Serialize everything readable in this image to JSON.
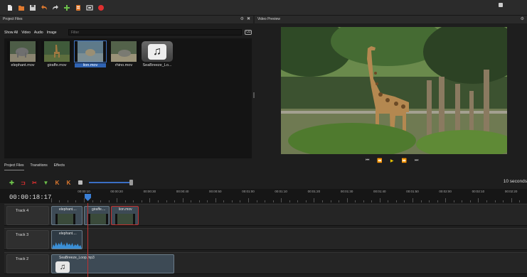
{
  "toolbar": {
    "buttons": [
      {
        "name": "new-project-icon",
        "color": "#e0e0e0"
      },
      {
        "name": "open-project-icon",
        "color": "#e07a2f"
      },
      {
        "name": "save-project-icon",
        "color": "#d8d8d8"
      },
      {
        "name": "undo-icon",
        "color": "#e07a2f"
      },
      {
        "name": "redo-icon",
        "color": "#cccccc"
      },
      {
        "name": "import-files-icon",
        "color": "#6cc04a"
      },
      {
        "name": "choose-profile-icon",
        "color": "#e07a2f"
      },
      {
        "name": "fullscreen-icon",
        "color": "#d8d8d8"
      },
      {
        "name": "export-video-icon",
        "color": "#e03030"
      }
    ]
  },
  "project_files": {
    "title": "Project Files",
    "filters": [
      "Show All",
      "Video",
      "Audio",
      "Image"
    ],
    "filter_placeholder": "Filter",
    "files": [
      {
        "label": "elephant.mov",
        "selected": false
      },
      {
        "label": "giraffe.mov",
        "selected": false
      },
      {
        "label": "lion.mov",
        "selected": true
      },
      {
        "label": "rhino.mov",
        "selected": false
      },
      {
        "label": "SeaBreeze_Lo...",
        "selected": false
      }
    ]
  },
  "bottom_tabs": [
    "Project Files",
    "Transitions",
    "Effects"
  ],
  "preview": {
    "title": "Video Preview"
  },
  "timeline": {
    "timecode": "00:00:18:17",
    "snap_label": "10 seconds",
    "tick_labels": [
      "00:00:10",
      "00:00:20",
      "00:00:30",
      "00:00:40",
      "00:00:50",
      "00:01:00",
      "00:01:10",
      "00:01:20",
      "00:01:30",
      "00:01:40",
      "00:01:50",
      "00:02:00",
      "00:02:10",
      "00:02:20"
    ],
    "tracks": [
      {
        "label": "Track 4",
        "clips": [
          "elephant....",
          "giraffe....",
          "lion.mov"
        ]
      },
      {
        "label": "Track 3",
        "clips": [
          "elephant...."
        ]
      },
      {
        "label": "Track 2",
        "clips": [
          "SeaBreeze_Loop.mp3"
        ]
      }
    ]
  }
}
